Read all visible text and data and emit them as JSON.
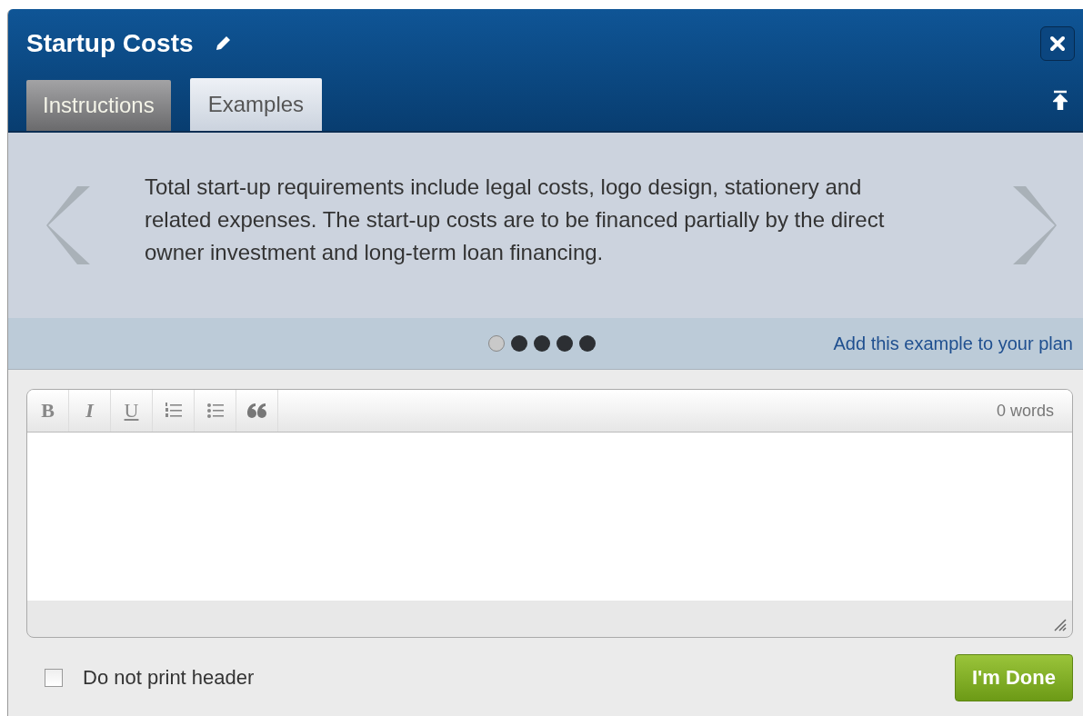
{
  "window": {
    "title": "Startup Costs"
  },
  "tabs": [
    {
      "label": "Instructions",
      "selected": false
    },
    {
      "label": "Examples",
      "selected": true
    }
  ],
  "example": {
    "text": "Total start-up requirements include legal costs, logo design, stationery and related expenses. The start-up costs are to be financed partially by the direct owner investment and long-term loan financing.",
    "pages": [
      {
        "selected": true
      },
      {
        "selected": false
      },
      {
        "selected": false
      },
      {
        "selected": false
      },
      {
        "selected": false
      }
    ],
    "add_link": "Add this example to your plan"
  },
  "toolbar": [
    {
      "kind": "bold",
      "label": "B"
    },
    {
      "kind": "italic",
      "label": "I"
    },
    {
      "kind": "underline",
      "label": "U"
    },
    {
      "kind": "ordered-list"
    },
    {
      "kind": "bullet-list"
    },
    {
      "kind": "quote"
    }
  ],
  "word_count": "0 words",
  "footer": {
    "checkbox": {
      "label": "Do not print header",
      "checked": false
    },
    "done_button": "I'm Done"
  }
}
